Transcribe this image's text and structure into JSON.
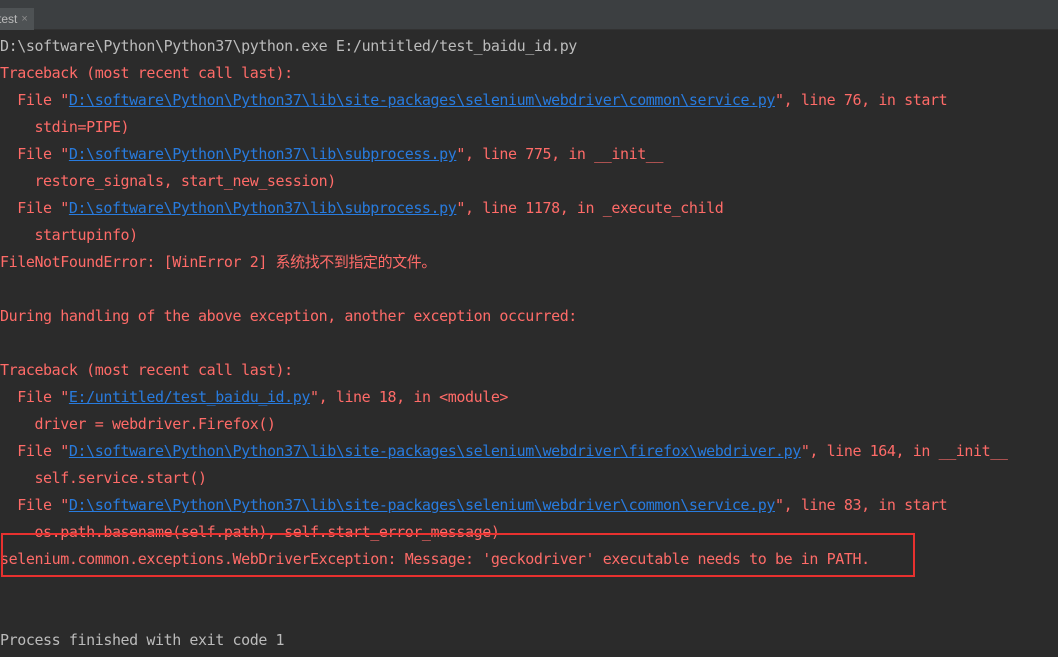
{
  "tab": {
    "label": "test",
    "close": "×"
  },
  "console": {
    "command": "D:\\software\\Python\\Python37\\python.exe E:/untitled/test_baidu_id.py",
    "tb1_header": "Traceback (most recent call last):",
    "tb1_f1_pre": "  File \"",
    "tb1_f1_link": "D:\\software\\Python\\Python37\\lib\\site-packages\\selenium\\webdriver\\common\\service.py",
    "tb1_f1_post": "\", line 76, in start",
    "tb1_f1_code": "    stdin=PIPE)",
    "tb1_f2_pre": "  File \"",
    "tb1_f2_link": "D:\\software\\Python\\Python37\\lib\\subprocess.py",
    "tb1_f2_post": "\", line 775, in __init__",
    "tb1_f2_code": "    restore_signals, start_new_session)",
    "tb1_f3_pre": "  File \"",
    "tb1_f3_link": "D:\\software\\Python\\Python37\\lib\\subprocess.py",
    "tb1_f3_post": "\", line 1178, in _execute_child",
    "tb1_f3_code": "    startupinfo)",
    "tb1_error": "FileNotFoundError: [WinError 2] 系统找不到指定的文件。",
    "during": "During handling of the above exception, another exception occurred:",
    "tb2_header": "Traceback (most recent call last):",
    "tb2_f1_pre": "  File \"",
    "tb2_f1_link": "E:/untitled/test_baidu_id.py",
    "tb2_f1_post": "\", line 18, in <module>",
    "tb2_f1_code": "    driver = webdriver.Firefox()",
    "tb2_f2_pre": "  File \"",
    "tb2_f2_link": "D:\\software\\Python\\Python37\\lib\\site-packages\\selenium\\webdriver\\firefox\\webdriver.py",
    "tb2_f2_post": "\", line 164, in __init__",
    "tb2_f2_code": "    self.service.start()",
    "tb2_f3_pre": "  File \"",
    "tb2_f3_link": "D:\\software\\Python\\Python37\\lib\\site-packages\\selenium\\webdriver\\common\\service.py",
    "tb2_f3_post": "\", line 83, in start",
    "tb2_f3_code": "    os.path.basename(self.path), self.start_error_message)",
    "tb2_error": "selenium.common.exceptions.WebDriverException: Message: 'geckodriver' executable needs to be in PATH.",
    "exit": "Process finished with exit code 1"
  },
  "colors": {
    "background": "#2b2b2b",
    "normal_text": "#bbbbbb",
    "error_text": "#ff6b68",
    "link": "#287bde",
    "highlight_border": "#e8312f"
  }
}
